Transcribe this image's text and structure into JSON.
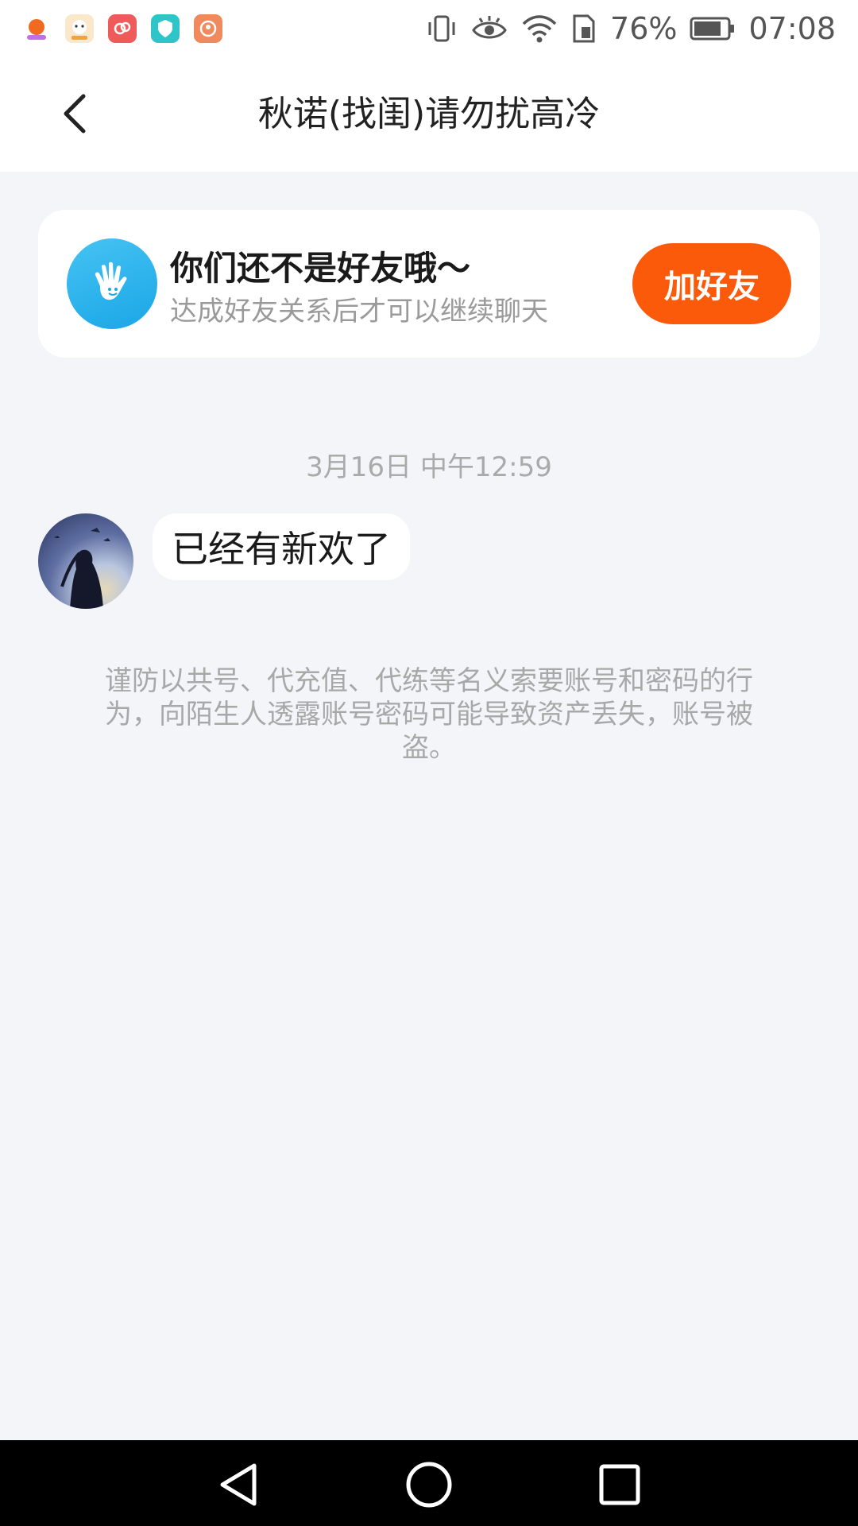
{
  "status_bar": {
    "battery_percent": "76%",
    "time": "07:08",
    "app_icons": [
      "app-icon-orange",
      "app-icon-cartoon",
      "app-icon-red",
      "app-icon-shield",
      "app-icon-orange-person"
    ],
    "status_icons": [
      "vibrate-icon",
      "eye-icon",
      "wifi-icon",
      "sim-icon",
      "battery-icon"
    ]
  },
  "header": {
    "title": "秋诺(找闺)请勿扰高冷",
    "back_icon": "chevron-left-icon"
  },
  "friend_card": {
    "title": "你们还不是好友哦～",
    "subtitle": "达成好友关系后才可以继续聊天",
    "button_label": "加好友",
    "icon": "wave-hand-icon",
    "colors": {
      "button": "#fb5a0a",
      "icon_bg": "#2db4ee"
    }
  },
  "chat": {
    "timestamp": "3月16日 中午12:59",
    "messages": [
      {
        "text": "已经有新欢了",
        "sender_avatar": "avatar"
      }
    ],
    "warning": "谨防以共号、代充值、代练等名义索要账号和密码的行为，向陌生人透露账号密码可能导致资产丢失，账号被盗。"
  },
  "nav_bar": {
    "icons": [
      "back-triangle-icon",
      "home-circle-icon",
      "recents-square-icon"
    ]
  }
}
